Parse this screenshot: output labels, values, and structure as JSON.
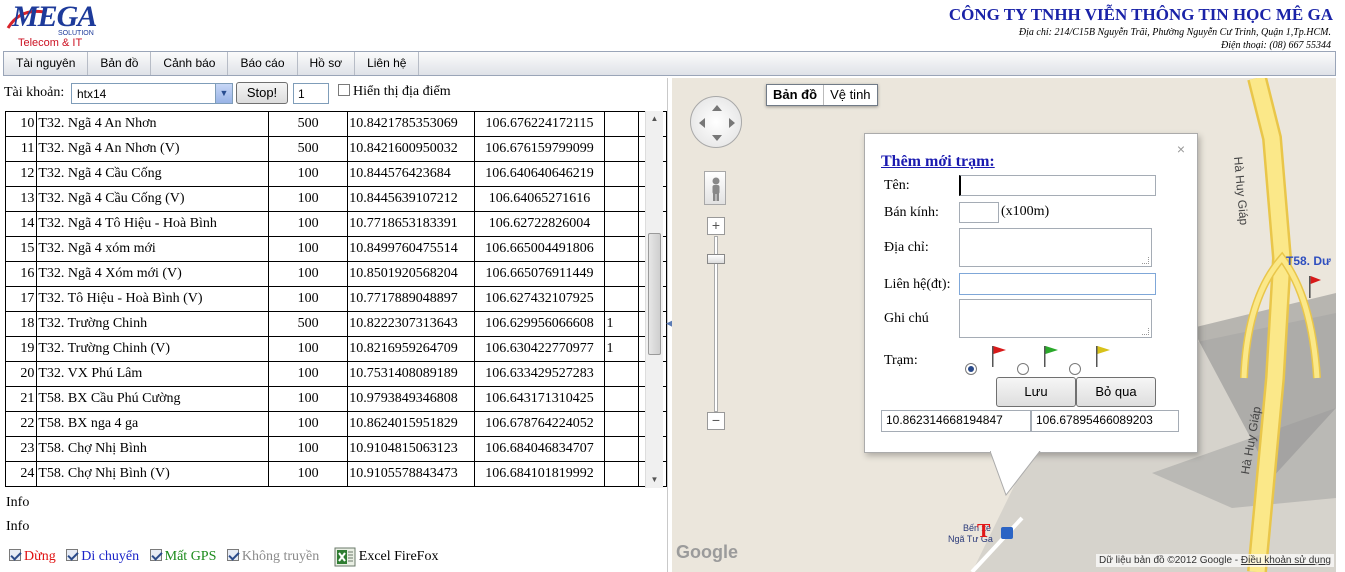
{
  "header": {
    "logo_text": "MEGA",
    "logo_solution": "SOLUTION",
    "logo_tagline": "Telecom & IT",
    "company_name": "CÔNG TY TNHH VIỄN THÔNG TIN HỌC MÊ GA",
    "address": "Địa chỉ: 214/C15B Nguyễn Trãi, Phường Nguyễn Cư Trinh, Quận 1,Tp.HCM.",
    "phone": "Điện thoại: (08) 667 55344"
  },
  "nav": {
    "items": [
      "Tài nguyên",
      "Bản đồ",
      "Cảnh báo",
      "Báo cáo",
      "Hồ sơ",
      "Liên hệ"
    ]
  },
  "toolbar": {
    "account_label": "Tài khoản:",
    "account_value": "htx14",
    "stop_label": "Stop!",
    "interval_value": "1",
    "show_places_label": "Hiển thị địa điểm"
  },
  "grid": {
    "rows": [
      {
        "num": "10",
        "name": "T32. Ngã 4 An Nhơn",
        "radius": "500",
        "lat": "10.8421785353069",
        "lng": "106.676224172115",
        "flag": ""
      },
      {
        "num": "11",
        "name": "T32. Ngã 4 An Nhơn (V)",
        "radius": "500",
        "lat": "10.8421600950032",
        "lng": "106.676159799099",
        "flag": ""
      },
      {
        "num": "12",
        "name": "T32. Ngã 4 Cầu Cống",
        "radius": "100",
        "lat": "10.844576423684",
        "lng": "106.640640646219",
        "flag": ""
      },
      {
        "num": "13",
        "name": "T32. Ngã 4 Cầu Cống (V)",
        "radius": "100",
        "lat": "10.8445639107212",
        "lng": "106.64065271616",
        "flag": ""
      },
      {
        "num": "14",
        "name": "T32. Ngã 4 Tô Hiệu - Hoà Bình",
        "radius": "100",
        "lat": "10.7718653183391",
        "lng": "106.62722826004",
        "flag": ""
      },
      {
        "num": "15",
        "name": "T32. Ngã 4 xóm mới",
        "radius": "100",
        "lat": "10.8499760475514",
        "lng": "106.665004491806",
        "flag": ""
      },
      {
        "num": "16",
        "name": "T32. Ngã 4 Xóm mới (V)",
        "radius": "100",
        "lat": "10.8501920568204",
        "lng": "106.665076911449",
        "flag": ""
      },
      {
        "num": "17",
        "name": "T32. Tô Hiệu - Hoà Bình (V)",
        "radius": "100",
        "lat": "10.7717889048897",
        "lng": "106.627432107925",
        "flag": ""
      },
      {
        "num": "18",
        "name": "T32. Trường Chinh",
        "radius": "500",
        "lat": "10.8222307313643",
        "lng": "106.629956066608",
        "flag": "1"
      },
      {
        "num": "19",
        "name": "T32. Trường Chinh (V)",
        "radius": "100",
        "lat": "10.8216959264709",
        "lng": "106.630422770977",
        "flag": "1"
      },
      {
        "num": "20",
        "name": "T32. VX Phú Lâm",
        "radius": "100",
        "lat": "10.7531408089189",
        "lng": "106.633429527283",
        "flag": ""
      },
      {
        "num": "21",
        "name": "T58. BX Cầu Phú Cường",
        "radius": "100",
        "lat": "10.9793849346808",
        "lng": "106.643171310425",
        "flag": ""
      },
      {
        "num": "22",
        "name": "T58. BX nga 4 ga",
        "radius": "100",
        "lat": "10.8624015951829",
        "lng": "106.67876422405​2",
        "flag": ""
      },
      {
        "num": "23",
        "name": "T58. Chợ Nhị Bình",
        "radius": "100",
        "lat": "10.9104815063123",
        "lng": "106.684046834707",
        "flag": ""
      },
      {
        "num": "24",
        "name": "T58. Chợ Nhị Bình (V)",
        "radius": "100",
        "lat": "10.9105578843473",
        "lng": "106.684101819992",
        "flag": ""
      }
    ]
  },
  "status": {
    "info1": "Info",
    "info2": "Info"
  },
  "legend": {
    "stop": "Dừng",
    "moving": "Di chuyển",
    "lost_gps": "Mất GPS",
    "no_transmit": "Không truyền",
    "excel": "Excel FireFox",
    "colors": {
      "stop": "#e01010",
      "moving": "#1a23c8",
      "lost_gps": "#1a8a1a",
      "no_transmit": "#8a8a8a"
    }
  },
  "map": {
    "type_map": "Bản đồ",
    "type_satellite": "Vệ tinh",
    "zoom_in": "+",
    "zoom_out": "−",
    "station_label": "T58. Dư",
    "street_1": "Hà Huy Giáp",
    "street_2": "Hà Huy Giáp",
    "bus_label_1": "Bến xe",
    "bus_label_2": "Ngã Tư Ga",
    "station_marker": "T",
    "google_logo": "Google",
    "copyright": "Dữ liệu bản đồ ©2012 Google -",
    "terms": "Điều khoản sử dụng"
  },
  "add_station": {
    "close": "×",
    "title": "Thêm mới trạm:",
    "name_label": "Tên:",
    "name_value": "",
    "radius_label": "Bán kính:",
    "radius_value": "",
    "radius_unit": "(x100m)",
    "address_label": "Địa chỉ:",
    "contact_label": "Liên hệ(đt):",
    "contact_value": "",
    "note_label": "Ghi chú",
    "station_label": "Trạm:",
    "flag_colors": [
      "#d81a1a",
      "#2aa82a",
      "#d8c21a"
    ],
    "save_label": "Lưu",
    "cancel_label": "Bỏ qua",
    "lat_value": "10.862314668194847",
    "lng_value": "106.67895466089203"
  }
}
